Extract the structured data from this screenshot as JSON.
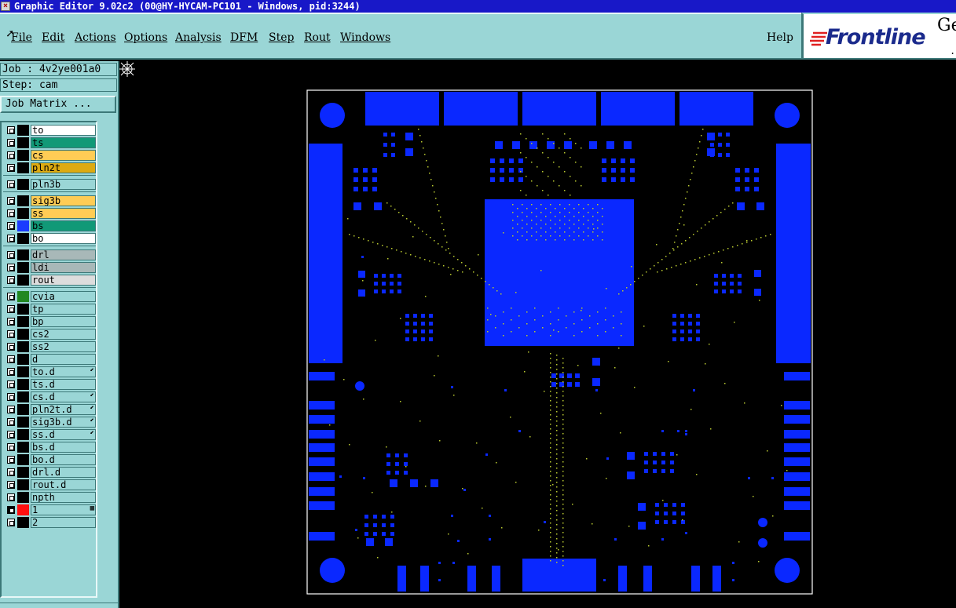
{
  "window": {
    "title": "Graphic Editor 9.02c2 (00@HY-HYCAM-PC101 - Windows, pid:3244)"
  },
  "menubar": {
    "items": [
      {
        "label": "File",
        "key": "file"
      },
      {
        "label": "Edit",
        "key": "edit"
      },
      {
        "label": "Actions",
        "key": "actions"
      },
      {
        "label": "Options",
        "key": "options"
      },
      {
        "label": "Analysis",
        "key": "analysis"
      },
      {
        "label": "DFM",
        "key": "dfm"
      },
      {
        "label": "Step",
        "key": "step"
      },
      {
        "label": "Rout",
        "key": "rout"
      },
      {
        "label": "Windows",
        "key": "windows"
      }
    ],
    "help_label": "Help"
  },
  "logo": {
    "text": "Frontline",
    "extra": "Ge",
    "brand_color": "#1a2a8c",
    "mark_color": "#e02020"
  },
  "job": {
    "job_line": "Job : 4v2ye001a0",
    "step_line": "Step: cam",
    "matrix_button": "Job Matrix ..."
  },
  "layers": [
    {
      "name": "to",
      "color": "#ffffff",
      "swatch": "#000000",
      "mark": ""
    },
    {
      "name": "ts",
      "color": "#119977",
      "swatch": "#000000",
      "mark": ""
    },
    {
      "name": "cs",
      "color": "#ffcc55",
      "swatch": "#000000",
      "mark": ""
    },
    {
      "name": "pln2t",
      "color": "#ddaa11",
      "swatch": "#000000",
      "mark": ""
    },
    {
      "name": "pln3b",
      "color": "#9ad6d6",
      "swatch": "#000000",
      "mark": ""
    },
    {
      "name": "sig3b",
      "color": "#ffcc55",
      "swatch": "#000000",
      "mark": ""
    },
    {
      "name": "ss",
      "color": "#ffcc55",
      "swatch": "#000000",
      "mark": ""
    },
    {
      "name": "bs",
      "color": "#119977",
      "swatch": "#1a3cff",
      "mark": ""
    },
    {
      "name": "bo",
      "color": "#ffffff",
      "swatch": "#000000",
      "mark": ""
    },
    {
      "name": "drl",
      "color": "#a8b8b8",
      "swatch": "#000000",
      "mark": ""
    },
    {
      "name": "ldi",
      "color": "#a8b8b8",
      "swatch": "#000000",
      "mark": ""
    },
    {
      "name": "rout",
      "color": "#dddddd",
      "swatch": "#000000",
      "mark": ""
    },
    {
      "name": "cvia",
      "color": "#9ad6d6",
      "swatch": "#228822",
      "mark": ""
    },
    {
      "name": "tp",
      "color": "#9ad6d6",
      "swatch": "#000000",
      "mark": ""
    },
    {
      "name": "bp",
      "color": "#9ad6d6",
      "swatch": "#000000",
      "mark": ""
    },
    {
      "name": "cs2",
      "color": "#9ad6d6",
      "swatch": "#000000",
      "mark": ""
    },
    {
      "name": "ss2",
      "color": "#9ad6d6",
      "swatch": "#000000",
      "mark": ""
    },
    {
      "name": "d",
      "color": "#9ad6d6",
      "swatch": "#000000",
      "mark": ""
    },
    {
      "name": "to.d",
      "color": "#9ad6d6",
      "swatch": "#000000",
      "mark": "⬋"
    },
    {
      "name": "ts.d",
      "color": "#9ad6d6",
      "swatch": "#000000",
      "mark": ""
    },
    {
      "name": "cs.d",
      "color": "#9ad6d6",
      "swatch": "#000000",
      "mark": "⬋"
    },
    {
      "name": "pln2t.d",
      "color": "#9ad6d6",
      "swatch": "#000000",
      "mark": "⬋"
    },
    {
      "name": "sig3b.d",
      "color": "#9ad6d6",
      "swatch": "#000000",
      "mark": "⬋"
    },
    {
      "name": "ss.d",
      "color": "#9ad6d6",
      "swatch": "#000000",
      "mark": "⬋"
    },
    {
      "name": "bs.d",
      "color": "#9ad6d6",
      "swatch": "#000000",
      "mark": ""
    },
    {
      "name": "bo.d",
      "color": "#9ad6d6",
      "swatch": "#000000",
      "mark": ""
    },
    {
      "name": "drl.d",
      "color": "#9ad6d6",
      "swatch": "#000000",
      "mark": ""
    },
    {
      "name": "rout.d",
      "color": "#9ad6d6",
      "swatch": "#000000",
      "mark": ""
    },
    {
      "name": "npth",
      "color": "#9ad6d6",
      "swatch": "#000000",
      "mark": ""
    },
    {
      "name": "1",
      "color": "#9ad6d6",
      "swatch": "#ff1010",
      "mark": "▦",
      "active": true
    },
    {
      "name": "2",
      "color": "#9ad6d6",
      "swatch": "#000000",
      "mark": ""
    }
  ],
  "board": {
    "copper_color": "#0a28ff",
    "outline_color": "#ffffff",
    "via_color": "#b8c830",
    "background": "#000000"
  }
}
